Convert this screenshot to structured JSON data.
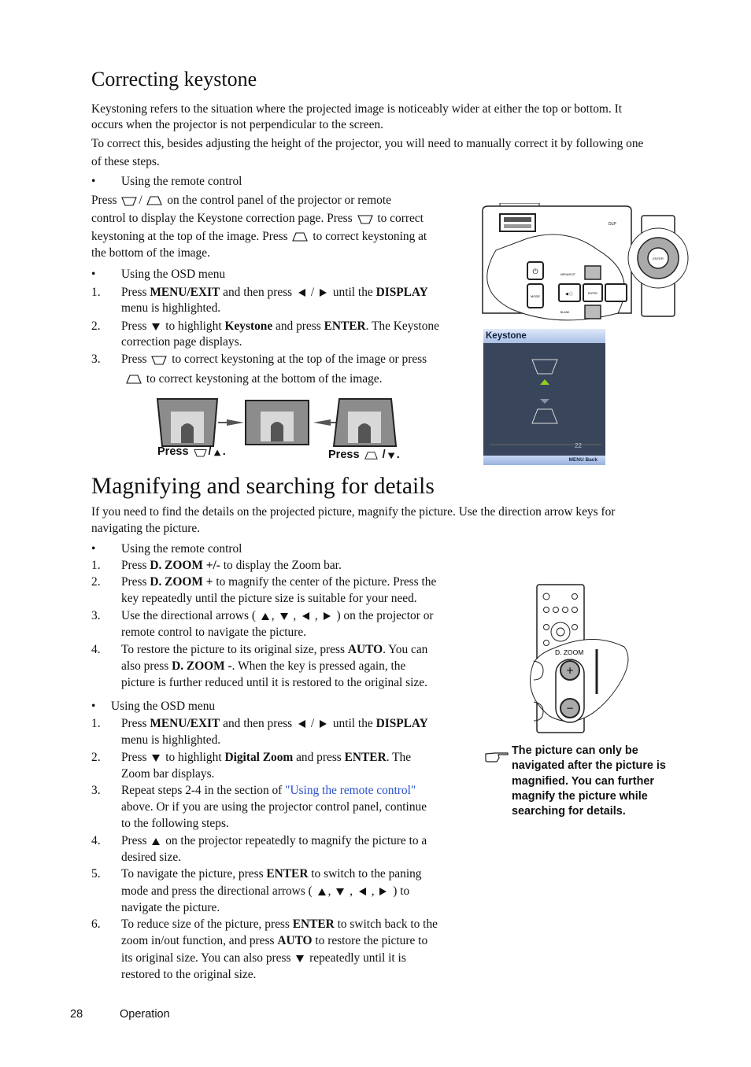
{
  "section1": {
    "title": "Correcting keystone",
    "lines": [
      {
        "kind": "para",
        "text": "Keystoning refers to the situation where the projected image is noticeably wider at either the top or bottom. It"
      },
      {
        "kind": "para",
        "text": "occurs when the projector is not perpendicular to the screen."
      },
      {
        "kind": "para",
        "text": "To correct this, besides adjusting the height of the projector, you will need to manually correct it by following one"
      },
      {
        "kind": "para",
        "text": "of these steps."
      },
      {
        "kind": "bullet",
        "text": "Using the remote control"
      },
      {
        "kind": "para",
        "text": "Press {KT}/ {KB} on the control panel of the projector or remote"
      },
      {
        "kind": "para",
        "text": "control to display the Keystone correction page. Press {KT} to correct"
      },
      {
        "kind": "para",
        "text": "keystoning at the top of the image. Press {KB} to correct keystoning at"
      },
      {
        "kind": "para",
        "text": "the bottom of the image."
      },
      {
        "kind": "bullet",
        "text": "Using the OSD menu"
      },
      {
        "kind": "step",
        "num": "1.",
        "text": "Press **MENU/EXIT** and then press {L} / {R} until the **DISPLAY**"
      },
      {
        "kind": "cont",
        "text": "menu is highlighted."
      },
      {
        "kind": "step",
        "num": "2.",
        "text": "Press {D} to highlight **Keystone** and press **ENTER**. The Keystone"
      },
      {
        "kind": "cont",
        "text": "correction page displays."
      },
      {
        "kind": "step",
        "num": "3.",
        "text": "Press {KT} to correct keystoning at the top of the image or press"
      },
      {
        "kind": "cont2",
        "text": "{KB} to correct keystoning at the bottom of the image."
      }
    ],
    "figure_captions": {
      "left": "Press {kt}/{U}.",
      "right": "Press {kb} /{D}."
    },
    "osd": {
      "title": "Keystone",
      "value": "22",
      "menu_label": "MENU",
      "back_label": "Back"
    }
  },
  "section2": {
    "title": "Magnifying and searching for details",
    "lines": [
      {
        "kind": "para",
        "text": "If you need to find the details on the projected picture, magnify the picture. Use the direction arrow keys for"
      },
      {
        "kind": "para",
        "text": "navigating the picture."
      },
      {
        "kind": "bullet",
        "text": "Using the remote control"
      },
      {
        "kind": "step",
        "num": "1.",
        "text": "Press **D. ZOOM +/-** to display the Zoom bar."
      },
      {
        "kind": "step",
        "num": "2.",
        "text": "Press **D. ZOOM +** to magnify the center of the picture. Press the"
      },
      {
        "kind": "cont",
        "text": "key repeatedly until the picture size is suitable for your need."
      },
      {
        "kind": "step",
        "num": "3.",
        "text": "Use the directional arrows ( {U}, {D} , {L} , {R} ) on the projector or"
      },
      {
        "kind": "cont",
        "text": "remote control to navigate the picture."
      },
      {
        "kind": "step",
        "num": "4.",
        "text": "To restore the picture to its original size, press **AUTO**. You can"
      },
      {
        "kind": "cont",
        "text": "also press **D. ZOOM -**. When the key is pressed again, the"
      },
      {
        "kind": "cont",
        "text": "picture is further reduced until it is restored to the original size."
      },
      {
        "kind": "bullet2",
        "text": "Using the OSD menu"
      },
      {
        "kind": "step",
        "num": "1.",
        "text": "Press **MENU/EXIT** and then press {L} / {R} until the **DISPLAY**"
      },
      {
        "kind": "cont",
        "text": "menu is highlighted."
      },
      {
        "kind": "step",
        "num": "2.",
        "text": "Press {D} to highlight **Digital Zoom** and press **ENTER**. The"
      },
      {
        "kind": "cont",
        "text": "Zoom bar displays."
      },
      {
        "kind": "step",
        "num": "3.",
        "text": "Repeat steps 2-4 in the section of [[\"Using the remote control\"]]"
      },
      {
        "kind": "cont",
        "text": "above. Or if you are using the projector control panel, continue"
      },
      {
        "kind": "cont",
        "text": "to the following steps."
      },
      {
        "kind": "step",
        "num": "4.",
        "text": "Press {U} on the projector repeatedly to magnify the picture to a"
      },
      {
        "kind": "cont",
        "text": "desired size."
      },
      {
        "kind": "step",
        "num": "5.",
        "text": "To navigate the picture, press **ENTER** to switch to the paning"
      },
      {
        "kind": "cont",
        "text": "mode and press the directional arrows ( {U}, {D} , {L} , {R} ) to"
      },
      {
        "kind": "cont",
        "text": "navigate the picture."
      },
      {
        "kind": "step",
        "num": "6.",
        "text": "To reduce size of the picture, press **ENTER** to switch back to the"
      },
      {
        "kind": "cont",
        "text": "zoom in/out function, and press **AUTO** to restore the picture to"
      },
      {
        "kind": "cont",
        "text": "its original size. You can also press {D} repeatedly until it is"
      },
      {
        "kind": "cont",
        "text": "restored to the original size."
      }
    ],
    "remote_label": "D. ZOOM",
    "note": {
      "icon": "pointing-hand-icon",
      "lines": [
        "The picture can only be",
        "navigated after the picture is",
        "magnified. You can further",
        "magnify the picture while",
        "searching for details."
      ]
    }
  },
  "panel_labels": {
    "menu": "MENU/EXIT",
    "mode": "MODE",
    "enter": "ENTER",
    "blank": "BLANK",
    "auto": "AUTO"
  },
  "footer": {
    "page_number": "28",
    "section": "Operation"
  },
  "colors": {
    "link": "#2a4fd0",
    "osd_bg": "#39455a",
    "osd_header": "#c9d8f4",
    "osd_arrow_active": "#8ed21e"
  }
}
